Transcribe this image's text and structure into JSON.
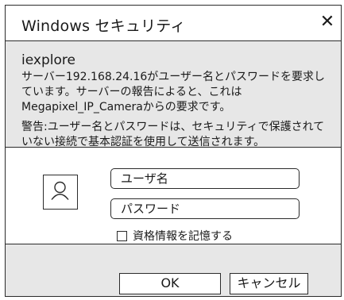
{
  "dialog": {
    "title": "Windows セキュリティ",
    "close_glyph": "✕",
    "app_name": "iexplore",
    "message": "サーバー192.168.24.16がユーザー名とパスワードを要求しています。サーバーの報告によると、これはMegapixel_IP_Cameraからの要求です。",
    "warning": "警告:ユーザー名とパスワードは、セキュリティで保護されていない接続で基本認証を使用して送信されます。"
  },
  "credentials": {
    "avatar_icon": "user-icon",
    "username_placeholder": "ユーザ名",
    "password_placeholder": "パスワード",
    "remember_label": "資格情報を記憶する",
    "remember_checked": false
  },
  "buttons": {
    "ok_label": "OK",
    "cancel_label": "キャンセル"
  }
}
